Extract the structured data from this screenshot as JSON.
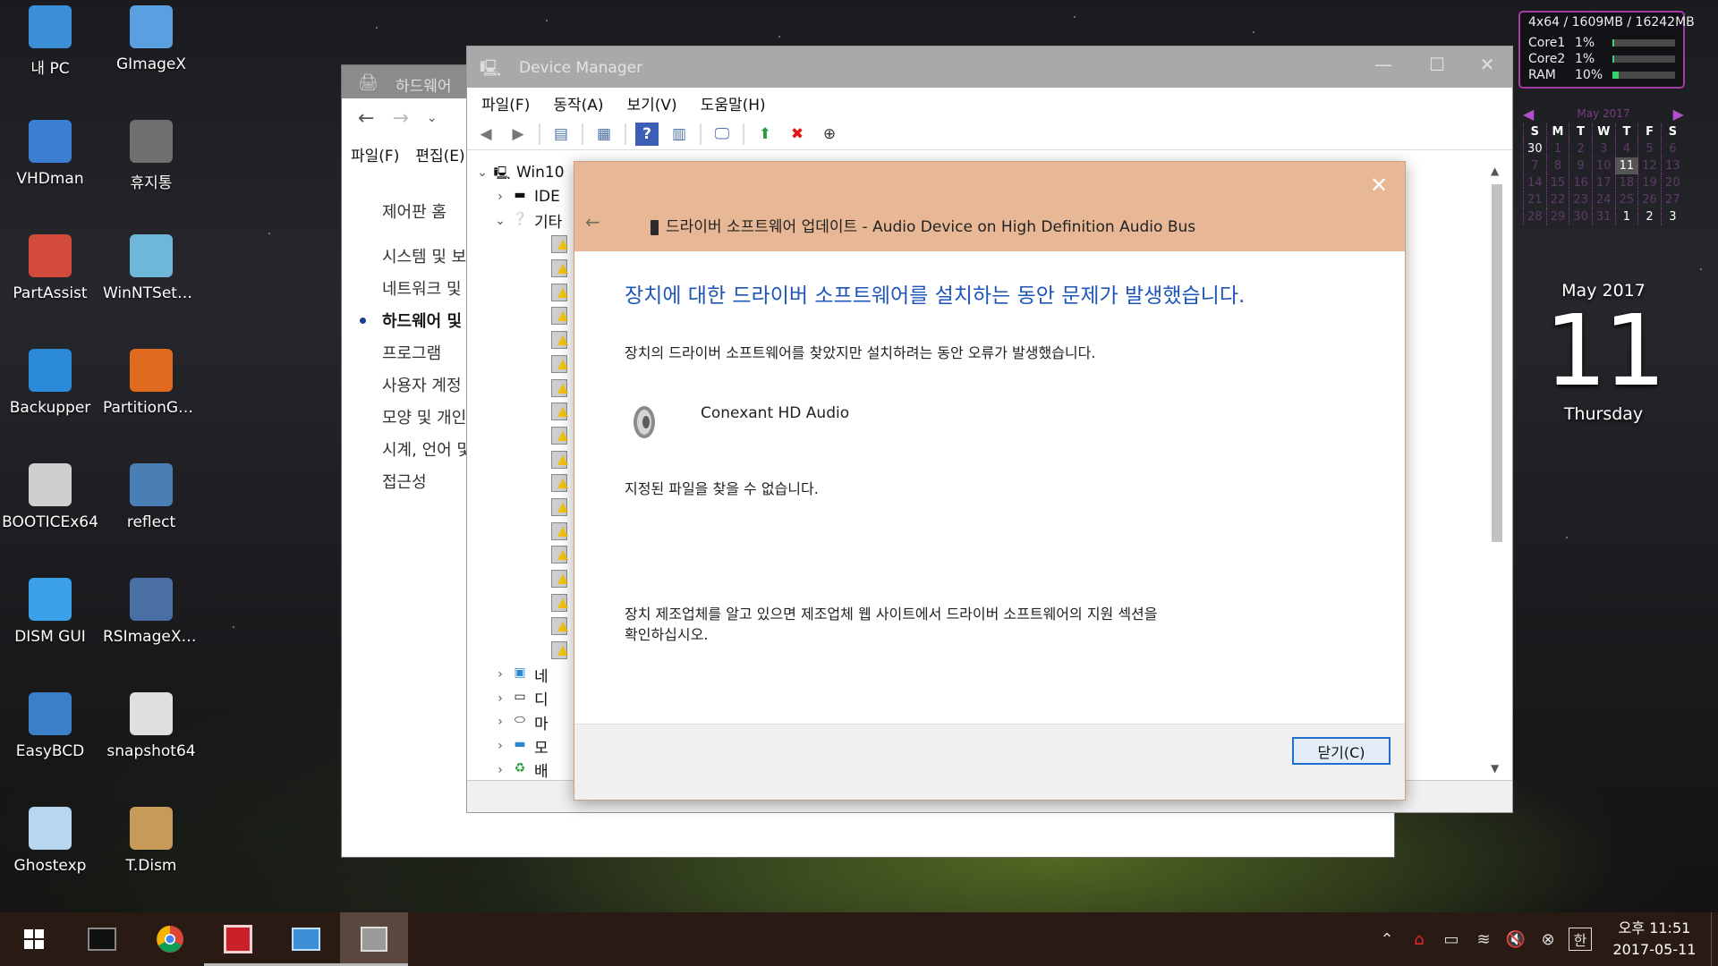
{
  "desktop": {
    "icons": [
      {
        "label": "내 PC",
        "icon": "computer-icon"
      },
      {
        "label": "GImageX",
        "icon": "gimagex-icon"
      },
      {
        "label": "VHDman",
        "icon": "vhdman-icon"
      },
      {
        "label": "휴지통",
        "icon": "recycle-bin-icon"
      },
      {
        "label": "PartAssist",
        "icon": "partassist-icon"
      },
      {
        "label": "WinNTSetu...",
        "icon": "winntsetup-icon"
      },
      {
        "label": "Backupper",
        "icon": "backupper-icon"
      },
      {
        "label": "PartitionGuru",
        "icon": "partitionguru-icon"
      },
      {
        "label": "BOOTICEx64",
        "icon": "bootice-icon"
      },
      {
        "label": "reflect",
        "icon": "reflect-icon"
      },
      {
        "label": "DISM GUI",
        "icon": "windows-logo-icon"
      },
      {
        "label": "RSImageX2...",
        "icon": "rsimagex-icon"
      },
      {
        "label": "EasyBCD",
        "icon": "easybcd-icon"
      },
      {
        "label": "snapshot64",
        "icon": "snapshot-icon"
      },
      {
        "label": "Ghostexp",
        "icon": "ghost-icon"
      },
      {
        "label": "T.Dism",
        "icon": "tdism-icon"
      }
    ]
  },
  "control_panel": {
    "title": "하드웨어",
    "menu": [
      "파일(F)",
      "편집(E)"
    ],
    "side_items": [
      "제어판 홈",
      "시스템 및 보",
      "네트워크 및",
      "하드웨어 및",
      "프로그램",
      "사용자 계정",
      "모양 및 개인",
      "시계, 언어 및",
      "접근성"
    ],
    "active_index": 3
  },
  "device_manager": {
    "title": "Device Manager",
    "menu": [
      "파일(F)",
      "동작(A)",
      "보기(V)",
      "도움말(H)"
    ],
    "tree": {
      "root": "Win10",
      "ide": "IDE",
      "other": "기타",
      "bottom": [
        "네",
        "디",
        "마",
        "모",
        "배"
      ]
    }
  },
  "dialog": {
    "header": "드라이버 소프트웨어 업데이트 - Audio Device on High Definition Audio Bus",
    "heading": "장치에 대한 드라이버 소프트웨어를 설치하는 동안 문제가 발생했습니다.",
    "sub": "장치의 드라이버 소프트웨어를 찾았지만 설치하려는 동안 오류가 발생했습니다.",
    "device_name": "Conexant HD Audio",
    "error": "지정된 파일을 찾을 수 없습니다.",
    "advice_line1": "장치 제조업체를 알고 있으면 제조업체 웹 사이트에서 드라이버 소프트웨어의 지원 섹션을",
    "advice_line2": "확인하십시오.",
    "close_button": "닫기(C)"
  },
  "sysmon": {
    "header": "4x64 / 1609MB / 16242MB",
    "rows": [
      {
        "name": "Core1",
        "value": "1%",
        "level": 0.01
      },
      {
        "name": "Core2",
        "value": "1%",
        "level": 0.01
      },
      {
        "name": "RAM",
        "value": "10%",
        "level": 0.1
      }
    ]
  },
  "calendar": {
    "month_title": "May 2017",
    "weekdays": [
      "S",
      "M",
      "T",
      "W",
      "T",
      "F",
      "S"
    ],
    "first_row": [
      "30",
      "1",
      "2",
      "3",
      "4",
      "5",
      "6"
    ],
    "last_row": [
      "28",
      "29",
      "30",
      "31",
      "1",
      "2",
      "3"
    ],
    "today": "11"
  },
  "date_widget": {
    "month_year": "May 2017",
    "day": "11",
    "weekday": "Thursday"
  },
  "taskbar": {
    "clock_time": "오후 11:51",
    "clock_date": "2017-05-11",
    "ime": "한"
  }
}
